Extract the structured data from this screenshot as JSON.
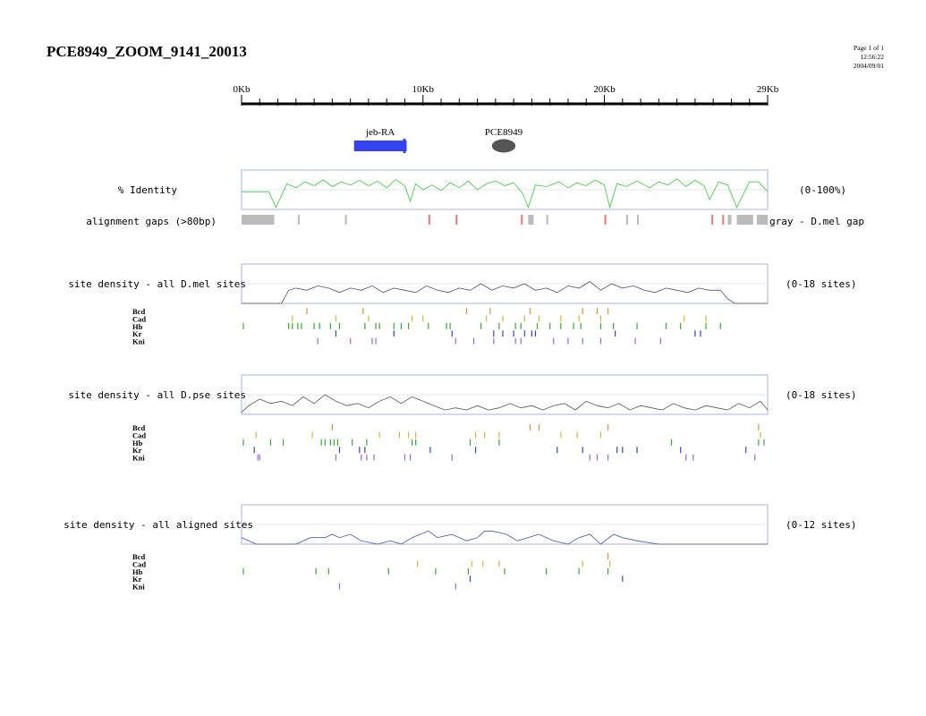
{
  "header": {
    "title": "PCE8949_ZOOM_9141_20013",
    "page_label": "Page 1 of 1",
    "time": "12:56:22",
    "date": "2004/09/01"
  },
  "scale": {
    "min_kb": 0,
    "max_kb": 29,
    "tick_labels": [
      {
        "kb": 0,
        "label": "0Kb"
      },
      {
        "kb": 10,
        "label": "10Kb"
      },
      {
        "kb": 20,
        "label": "20Kb"
      },
      {
        "kb": 29,
        "label": "29Kb"
      }
    ]
  },
  "features": [
    {
      "label": "jeb-RA",
      "type": "gene",
      "start_kb": 6.2,
      "end_kb": 9.1,
      "color": "#3344ee"
    },
    {
      "label": "PCE8949",
      "type": "crm",
      "start_kb": 13.8,
      "end_kb": 15.1,
      "color": "#555555"
    }
  ],
  "colors": {
    "identity": "#33cc33",
    "density": "#555555",
    "panel_border": "#aab0e8",
    "gap_gray": "#bbbbbb",
    "gap_red": "#ee7777",
    "Bcd": "#ee8833",
    "Cad": "#ccbb33",
    "Hb": "#33aa33",
    "Kr": "#3344cc",
    "Kni": "#9966dd"
  },
  "tracks": {
    "identity": {
      "label": "% Identity",
      "range_label": "(0-100%)"
    },
    "gaps": {
      "label": "alignment gaps (>80bp)",
      "legend": "gray - D.mel gap"
    },
    "dmel": {
      "label": "site density - all D.mel sites",
      "range_label": "(0-18 sites)"
    },
    "dpse": {
      "label": "site density - all D.pse sites",
      "range_label": "(0-18 sites)"
    },
    "aligned": {
      "label": "site density - all aligned sites",
      "range_label": "(0-12 sites)"
    }
  },
  "factor_names": [
    "Bcd",
    "Cad",
    "Hb",
    "Kr",
    "Kni"
  ],
  "chart_data": [
    {
      "type": "line",
      "name": "% Identity",
      "ylim": [
        0,
        100
      ],
      "x_kb": [
        0,
        1.5,
        1.9,
        2.5,
        3,
        3.5,
        4,
        4.5,
        5,
        5.5,
        6,
        6.5,
        7,
        7.5,
        8,
        8.5,
        9,
        9.3,
        9.6,
        10,
        10.5,
        11,
        11.5,
        12,
        12.5,
        13,
        13.5,
        14,
        14.5,
        15,
        15.5,
        15.8,
        16.2,
        16.8,
        17.5,
        18,
        18.5,
        19,
        19.5,
        20,
        20.3,
        20.7,
        21.2,
        21.8,
        22.5,
        23,
        23.5,
        24,
        24.5,
        25,
        25.5,
        25.8,
        26.3,
        26.8,
        27.3,
        28,
        28.5,
        29
      ],
      "y": [
        45,
        45,
        5,
        65,
        55,
        70,
        60,
        75,
        58,
        70,
        62,
        74,
        60,
        72,
        55,
        76,
        60,
        20,
        65,
        50,
        62,
        48,
        68,
        55,
        72,
        50,
        65,
        72,
        60,
        68,
        40,
        5,
        62,
        58,
        70,
        55,
        68,
        60,
        75,
        62,
        5,
        66,
        58,
        72,
        55,
        70,
        62,
        78,
        58,
        74,
        60,
        25,
        70,
        62,
        5,
        70,
        70,
        45
      ]
    },
    {
      "type": "segments",
      "name": "alignment gaps (>80bp)",
      "gray_kb": [
        [
          0,
          1.8
        ],
        [
          3.1,
          3.2
        ],
        [
          5.7,
          5.8
        ],
        [
          15.8,
          16.1
        ],
        [
          16.8,
          16.9
        ],
        [
          21.2,
          21.3
        ],
        [
          21.8,
          21.9
        ],
        [
          26.8,
          27.0
        ],
        [
          27.3,
          28.2
        ],
        [
          28.4,
          29.0
        ]
      ],
      "red_kb": [
        [
          10.3,
          10.4
        ],
        [
          11.8,
          11.9
        ],
        [
          15.4,
          15.5
        ],
        [
          20.0,
          20.1
        ],
        [
          25.9,
          26.0
        ],
        [
          26.5,
          26.6
        ]
      ]
    },
    {
      "type": "line",
      "name": "site density - all D.mel sites",
      "ylim": [
        0,
        18
      ],
      "x_kb": [
        0,
        2.2,
        2.6,
        3,
        3.6,
        4.2,
        4.8,
        5.4,
        6,
        6.6,
        7.2,
        7.8,
        8.4,
        9,
        9.6,
        10.2,
        10.8,
        11.4,
        12,
        12.6,
        13.2,
        13.8,
        14.4,
        15,
        15.6,
        16.2,
        16.8,
        17.4,
        18,
        18.6,
        19.2,
        19.8,
        20.4,
        21,
        21.6,
        22.2,
        22.8,
        23.4,
        24,
        24.6,
        25.2,
        25.8,
        26.4,
        26.8,
        27.2,
        29
      ],
      "y": [
        0,
        0,
        6,
        7,
        6,
        8,
        7,
        5,
        7,
        6,
        8,
        5,
        7,
        6,
        5,
        8,
        6,
        5,
        7,
        6,
        9,
        6,
        8,
        7,
        9,
        6,
        7,
        5,
        8,
        7,
        10,
        6,
        9,
        7,
        8,
        6,
        5,
        7,
        6,
        5,
        7,
        6,
        6,
        2,
        0,
        0
      ]
    },
    {
      "type": "line",
      "name": "site density - all D.pse sites",
      "ylim": [
        0,
        18
      ],
      "x_kb": [
        0,
        0.4,
        1,
        1.6,
        2.2,
        2.8,
        3.4,
        4,
        4.6,
        5.2,
        5.8,
        6.4,
        7,
        7.6,
        8.2,
        8.8,
        9.4,
        10,
        10.6,
        11.2,
        11.8,
        12.4,
        13,
        13.6,
        14.2,
        14.8,
        15.4,
        16,
        16.6,
        17.2,
        17.8,
        18.4,
        19,
        19.6,
        20.2,
        20.8,
        21.4,
        22,
        22.6,
        23.2,
        23.8,
        24.4,
        25,
        25.6,
        26.2,
        26.8,
        27.4,
        28,
        28.6,
        29
      ],
      "y": [
        1,
        4,
        7,
        5,
        6,
        4,
        8,
        5,
        9,
        6,
        4,
        5,
        3,
        6,
        8,
        5,
        8,
        6,
        4,
        2,
        3,
        2,
        4,
        2,
        3,
        5,
        3,
        4,
        2,
        4,
        5,
        2,
        6,
        4,
        3,
        5,
        2,
        4,
        3,
        2,
        5,
        3,
        2,
        4,
        3,
        2,
        5,
        3,
        6,
        2
      ]
    },
    {
      "type": "line",
      "name": "site density - all aligned sites",
      "ylim": [
        0,
        12
      ],
      "x_kb": [
        0,
        0.4,
        0.8,
        3,
        3.8,
        4.6,
        5,
        5.4,
        6,
        6.6,
        7.5,
        8.2,
        8.8,
        9.4,
        10.3,
        10.8,
        11.6,
        12.4,
        13,
        13.4,
        13.8,
        14.6,
        15.2,
        16.4,
        17.2,
        18,
        18.6,
        19.2,
        19.8,
        20.5,
        21,
        21.8,
        23,
        29
      ],
      "y": [
        2,
        1,
        0,
        0,
        2,
        2,
        3,
        2,
        3,
        1,
        0,
        1,
        0,
        2,
        4,
        2,
        3,
        1,
        2,
        4,
        4,
        3,
        1,
        3,
        1,
        0,
        2,
        3,
        0,
        3,
        2,
        1,
        0,
        0
      ]
    },
    {
      "type": "ticks",
      "name": "D.mel sites",
      "sites_kb": {
        "Bcd": [
          3.6,
          6.7,
          12.4,
          13.7,
          15.9,
          18.8,
          19.6,
          20.2
        ],
        "Cad": [
          2.8,
          5.2,
          7.0,
          9.4,
          10.0,
          13.5,
          14.4,
          15.6,
          16.4,
          17.6,
          18.6,
          19.8,
          24.4,
          25.6
        ],
        "Hb": [
          0.1,
          2.6,
          2.8,
          3.1,
          3.3,
          4.0,
          4.3,
          4.9,
          5.4,
          6.8,
          7.4,
          7.6,
          8.4,
          8.8,
          9.2,
          10.3,
          11.3,
          11.5,
          13.2,
          14.2,
          15.1,
          15.4,
          16.3,
          17.0,
          17.6,
          18.3,
          18.7,
          19.8,
          20.5,
          21.8,
          23.4,
          24.2,
          25.6,
          26.4
        ],
        "Kr": [
          5.2,
          8.4,
          11.6,
          13.9,
          14.4,
          15.0,
          15.6,
          16.0,
          16.2,
          20.6,
          25.0,
          25.3
        ],
        "Kni": [
          4.2,
          6.0,
          7.2,
          7.4,
          11.8,
          12.8,
          13.9,
          15.1,
          15.4,
          17.2,
          18.0,
          18.8,
          19.8,
          21.7,
          23.1
        ]
      }
    },
    {
      "type": "ticks",
      "name": "D.pse sites",
      "sites_kb": {
        "Bcd": [
          5.0,
          15.9,
          16.4,
          20.2,
          28.5
        ],
        "Cad": [
          0.8,
          3.9,
          7.6,
          8.7,
          9.2,
          9.6,
          12.9,
          13.4,
          14.2,
          17.6,
          18.5,
          19.8,
          28.6
        ],
        "Hb": [
          0.1,
          1.6,
          2.3,
          4.4,
          4.6,
          4.9,
          5.1,
          5.3,
          6.1,
          6.9,
          9.4,
          9.6,
          12.6,
          14.2,
          23.7,
          28.5,
          28.8
        ],
        "Kr": [
          0.7,
          5.4,
          6.5,
          6.8,
          10.4,
          12.9,
          17.4,
          18.8,
          20.7,
          21.0,
          21.8,
          24.2,
          27.8
        ],
        "Kni": [
          0.9,
          1.0,
          5.2,
          6.6,
          6.9,
          7.3,
          9.0,
          9.3,
          11.6,
          19.2,
          19.6,
          20.2,
          24.5,
          24.9,
          28.3
        ]
      }
    },
    {
      "type": "ticks",
      "name": "aligned sites",
      "sites_kb": {
        "Bcd": [
          20.2
        ],
        "Cad": [
          9.7,
          12.7,
          13.3,
          14.2,
          18.8,
          20.3
        ],
        "Hb": [
          0.1,
          4.1,
          4.8,
          8.1,
          10.7,
          12.5,
          14.5,
          16.8,
          18.6,
          20.2
        ],
        "Kr": [
          12.6,
          21.0
        ],
        "Kni": [
          5.4,
          11.8
        ]
      }
    }
  ]
}
